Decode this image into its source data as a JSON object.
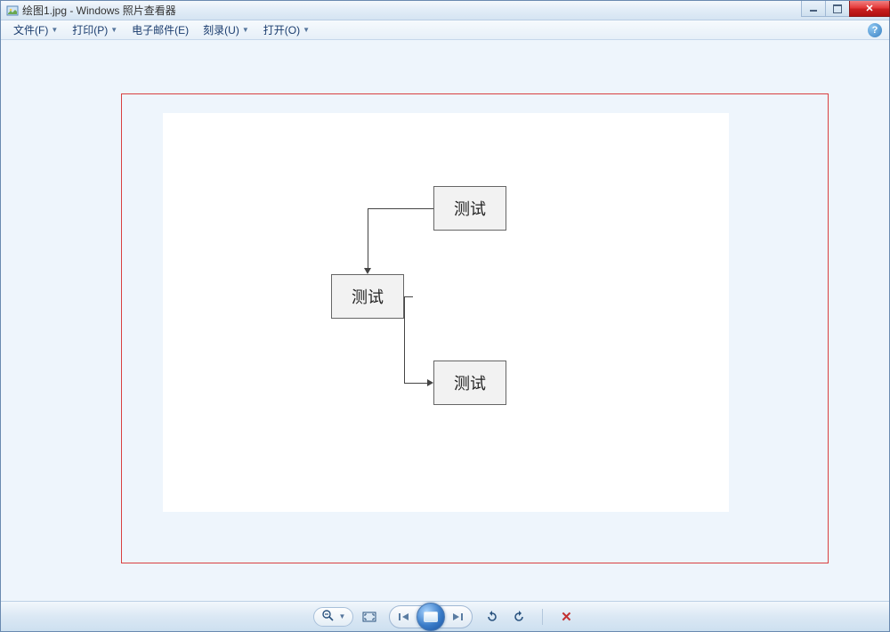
{
  "window": {
    "title": "绘图1.jpg - Windows 照片查看器"
  },
  "menu": {
    "file": "文件(F)",
    "print": "打印(P)",
    "email": "电子邮件(E)",
    "burn": "刻录(U)",
    "open": "打开(O)"
  },
  "diagram": {
    "box1": "测试",
    "box2": "测试",
    "box3": "测试"
  },
  "toolbar": {
    "zoom_icon": "zoom",
    "fit_icon": "fit",
    "prev_icon": "prev",
    "next_icon": "next",
    "slideshow_icon": "slideshow",
    "rotate_ccw_icon": "rotate-ccw",
    "rotate_cw_icon": "rotate-cw",
    "delete_icon": "delete"
  }
}
